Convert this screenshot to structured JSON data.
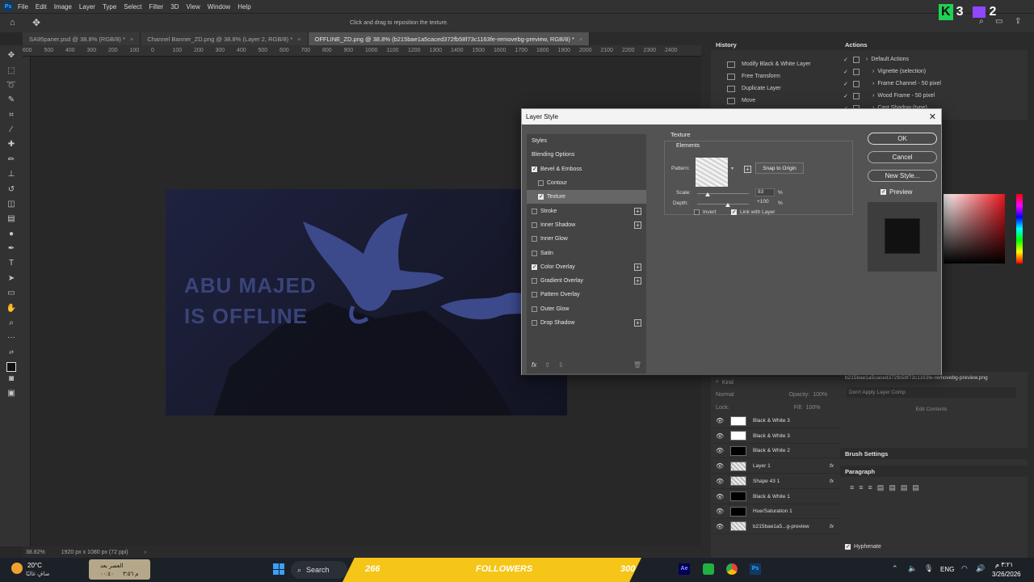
{
  "menu": [
    "File",
    "Edit",
    "Image",
    "Layer",
    "Type",
    "Select",
    "Filter",
    "3D",
    "View",
    "Window",
    "Help"
  ],
  "app_icon": "Ps",
  "options_hint": "Click and drag to reposition the texture.",
  "doc_tabs": [
    {
      "label": "SA95paner.psd @ 38.8% (RGB/8) *"
    },
    {
      "label": "Channel Banner_ZD.png @ 38.8% (Layer 2, RGB/8) *"
    },
    {
      "label": "OFFLINE_ZD.png @ 38.8% (b215bae1a5caced372fb58f73c1163fe-removebg-preview, RGB/8) *"
    }
  ],
  "ruler_ticks": [
    "600",
    "500",
    "400",
    "300",
    "200",
    "100",
    "0",
    "100",
    "200",
    "300",
    "400",
    "500",
    "600",
    "700",
    "800",
    "900",
    "1000",
    "1100",
    "1200",
    "1300",
    "1400",
    "1500",
    "1600",
    "1700",
    "1800",
    "1900",
    "2000",
    "2100",
    "2200",
    "2300",
    "2400"
  ],
  "artwork": {
    "line1": "ABU MAJED",
    "line2": "IS OFFLINE"
  },
  "status": {
    "zoom": "38.82%",
    "size": "1920 px x 1080 px (72 ppi)"
  },
  "history": {
    "title": "History",
    "items": [
      "Modify Black & White Layer",
      "Free Transform",
      "Duplicate Layer",
      "Move"
    ]
  },
  "actions": {
    "title": "Actions",
    "items": [
      "Default Actions",
      "Vignette (selection)",
      "Frame Channel - 50 pixel",
      "Wood Frame - 50 pixel",
      "Cast Shadow (type)"
    ]
  },
  "dialog": {
    "title": "Layer Style",
    "styles_header": "Styles",
    "styles": [
      {
        "label": "Blending Options",
        "checkbox": false,
        "has_cb": false,
        "plus": false
      },
      {
        "label": "Bevel & Emboss",
        "checkbox": true,
        "has_cb": true,
        "plus": false
      },
      {
        "label": "Contour",
        "checkbox": false,
        "has_cb": true,
        "plus": false,
        "indent": true
      },
      {
        "label": "Texture",
        "checkbox": true,
        "has_cb": true,
        "plus": false,
        "indent": true,
        "selected": true
      },
      {
        "label": "Stroke",
        "checkbox": false,
        "has_cb": true,
        "plus": true
      },
      {
        "label": "Inner Shadow",
        "checkbox": false,
        "has_cb": true,
        "plus": true
      },
      {
        "label": "Inner Glow",
        "checkbox": false,
        "has_cb": true,
        "plus": false
      },
      {
        "label": "Satin",
        "checkbox": false,
        "has_cb": true,
        "plus": false
      },
      {
        "label": "Color Overlay",
        "checkbox": true,
        "has_cb": true,
        "plus": true
      },
      {
        "label": "Gradient Overlay",
        "checkbox": false,
        "has_cb": true,
        "plus": true
      },
      {
        "label": "Pattern Overlay",
        "checkbox": false,
        "has_cb": true,
        "plus": false
      },
      {
        "label": "Outer Glow",
        "checkbox": false,
        "has_cb": true,
        "plus": false
      },
      {
        "label": "Drop Shadow",
        "checkbox": false,
        "has_cb": true,
        "plus": true
      }
    ],
    "section": "Texture",
    "group": "Elements",
    "pattern_label": "Pattern:",
    "snap_label": "Snap to Origin",
    "scale_label": "Scale:",
    "scale_value": "83",
    "depth_label": "Depth:",
    "depth_value": "+100",
    "percent": "%",
    "invert_label": "Invert",
    "link_label": "Link with Layer",
    "link_checked": true,
    "invert_checked": false,
    "scale_level": 0.2,
    "depth_level": 0.6,
    "ok": "OK",
    "cancel": "Cancel",
    "new_style": "New Style...",
    "preview": "Preview",
    "fx": "fx"
  },
  "layers": {
    "search_placeholder": "Kind",
    "blend": "Normal",
    "opacity_label": "Opacity:",
    "opacity_value": "100%",
    "lock_label": "Lock:",
    "fill_label": "Fill:",
    "fill_value": "100%",
    "rows": [
      {
        "name": "Black & White 3",
        "thumb": "bw",
        "fx": false
      },
      {
        "name": "Black & White 3",
        "thumb": "bw",
        "fx": false
      },
      {
        "name": "Black & White 2",
        "thumb": "black",
        "fx": false
      },
      {
        "name": "Layer 1",
        "thumb": "pat",
        "fx": true
      },
      {
        "name": "Shape 43 1",
        "thumb": "pat",
        "fx": true
      },
      {
        "name": "Black & White 1",
        "thumb": "black",
        "fx": false
      },
      {
        "name": "Hue/Saturation 1",
        "thumb": "black",
        "fx": false
      },
      {
        "name": "b215bae1a5...g-preview",
        "thumb": "pat",
        "fx": true
      }
    ]
  },
  "properties": {
    "filename": "b215bae1a5caced372fb58f73c1163fe-removebg-preview.png",
    "dont_apply": "Don't Apply Layer Comp",
    "edit_contents": "Edit Contents"
  },
  "brush_settings": "Brush Settings",
  "paragraph": "Paragraph",
  "hyphenate": "Hyphenate",
  "overlay": {
    "k": "K",
    "k_num": "3",
    "num2": "2"
  },
  "taskbar": {
    "temp": "20°C",
    "weather": "صافٍ غالبًا",
    "prayer_line1": "العصر بعد",
    "prayer_line2": "م ٣:٥٦",
    "prayer_line3": "٠٠:٤٠",
    "search": "Search",
    "followers_left": "266",
    "followers_label": "FOLLOWERS",
    "followers_right": "300",
    "lang": "ENG",
    "time": "٣:٢١ م",
    "date": "3/26/2026"
  },
  "colors": {
    "accent": "#31a8ff",
    "followers_bg": "#f5c518",
    "red": "#e8141c"
  }
}
